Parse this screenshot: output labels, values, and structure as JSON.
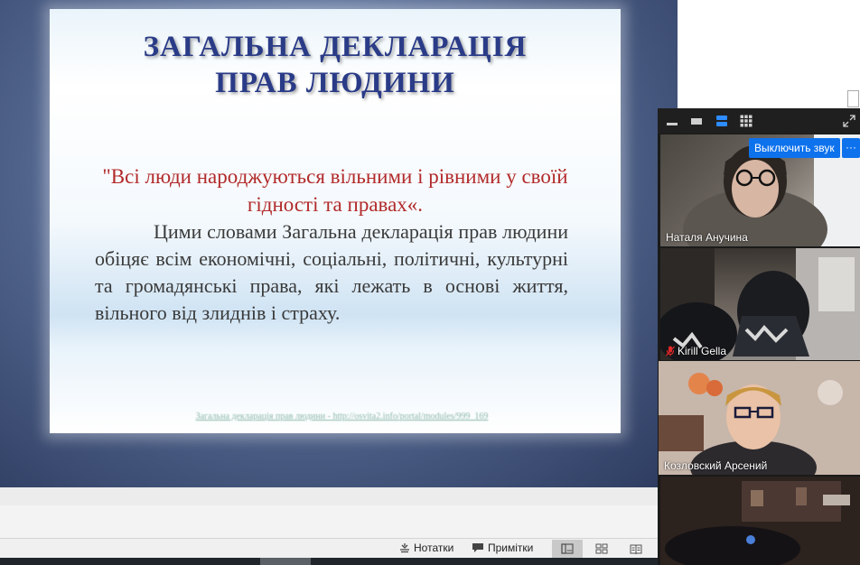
{
  "slide": {
    "title_line1": "ЗАГАЛЬНА ДЕКЛАРАЦІЯ",
    "title_line2": "ПРАВ ЛЮДИНИ",
    "quote": "\"Всі люди народжуються вільними і рівними у своїй гідності та правах«.",
    "body": "Цими словами Загальна декларація прав людини обіцяє всім економічні, соціальні, політичні, культурні та громадянські права, які лежать в основі життя, вільного від злиднів і страху.",
    "link": "Загальна декларація прав людини - http://osvita2.info/portal/modules/999_169"
  },
  "statusbar": {
    "notes_label": "Нотатки",
    "comments_label": "Примітки"
  },
  "zoom": {
    "mute_button_label": "Выключить звук",
    "more_button_label": "···",
    "participants": [
      {
        "name": "Наталя Анучина",
        "muted": false
      },
      {
        "name": "Kirill Gella",
        "muted": true
      },
      {
        "name": "Козловский Арсений",
        "muted": false,
        "active_speaker": true
      },
      {
        "name": "",
        "muted": false
      }
    ]
  },
  "colors": {
    "title": "#2a3b87",
    "quote": "#b22a2a",
    "zoom_accent": "#0e72ed",
    "active_speaker": "#2bd46a",
    "muted_icon": "#e02828"
  }
}
